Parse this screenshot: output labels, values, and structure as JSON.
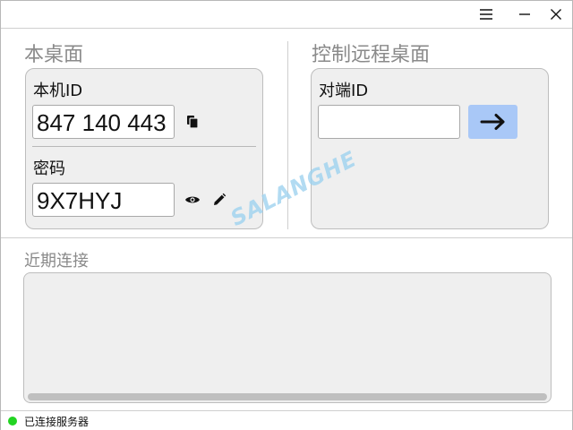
{
  "window": {
    "menu_icon": "hamburger-menu-icon",
    "minimize_icon": "minimize-icon",
    "close_icon": "close-icon"
  },
  "local_desktop": {
    "title": "本桌面",
    "id_label": "本机ID",
    "id_value": "847 140 443",
    "copy_icon": "copy-icon",
    "password_label": "密码",
    "password_value": "9X7HYJ",
    "show_icon": "eye-icon",
    "edit_icon": "pencil-icon"
  },
  "remote_desktop": {
    "title": "控制远程桌面",
    "peer_id_label": "对端ID",
    "peer_id_value": "",
    "connect_icon": "arrow-right-icon",
    "connect_button_color": "#a9c8f7"
  },
  "recent": {
    "title": "近期连接"
  },
  "watermark": "SALANGHE",
  "status": {
    "text": "已连接服务器",
    "indicator_color": "#22d422"
  }
}
